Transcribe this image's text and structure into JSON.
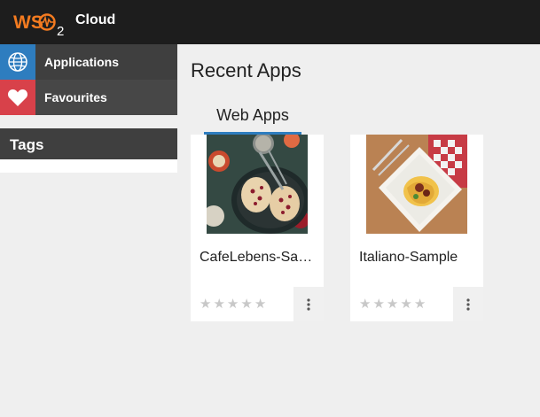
{
  "header": {
    "logo_text": "WSO2",
    "product": "Cloud",
    "colors": {
      "bar": "#1d1d1d",
      "logo": "#f47b20"
    }
  },
  "sidebar": {
    "items": [
      {
        "label": "Applications",
        "icon": "globe-icon",
        "color": "#2e7dbf"
      },
      {
        "label": "Favourites",
        "icon": "heart-icon",
        "color": "#d8414a"
      }
    ],
    "tags_title": "Tags"
  },
  "main": {
    "title": "Recent Apps",
    "tabs": [
      {
        "label": "Web Apps",
        "active": true
      }
    ],
    "apps": [
      {
        "name": "CafeLebens-Sample",
        "rating": 0,
        "max_rating": 5,
        "thumbnail": "food-photo-pastry"
      },
      {
        "name": "Italiano-Sample",
        "rating": 0,
        "max_rating": 5,
        "thumbnail": "food-photo-pasta"
      }
    ]
  }
}
